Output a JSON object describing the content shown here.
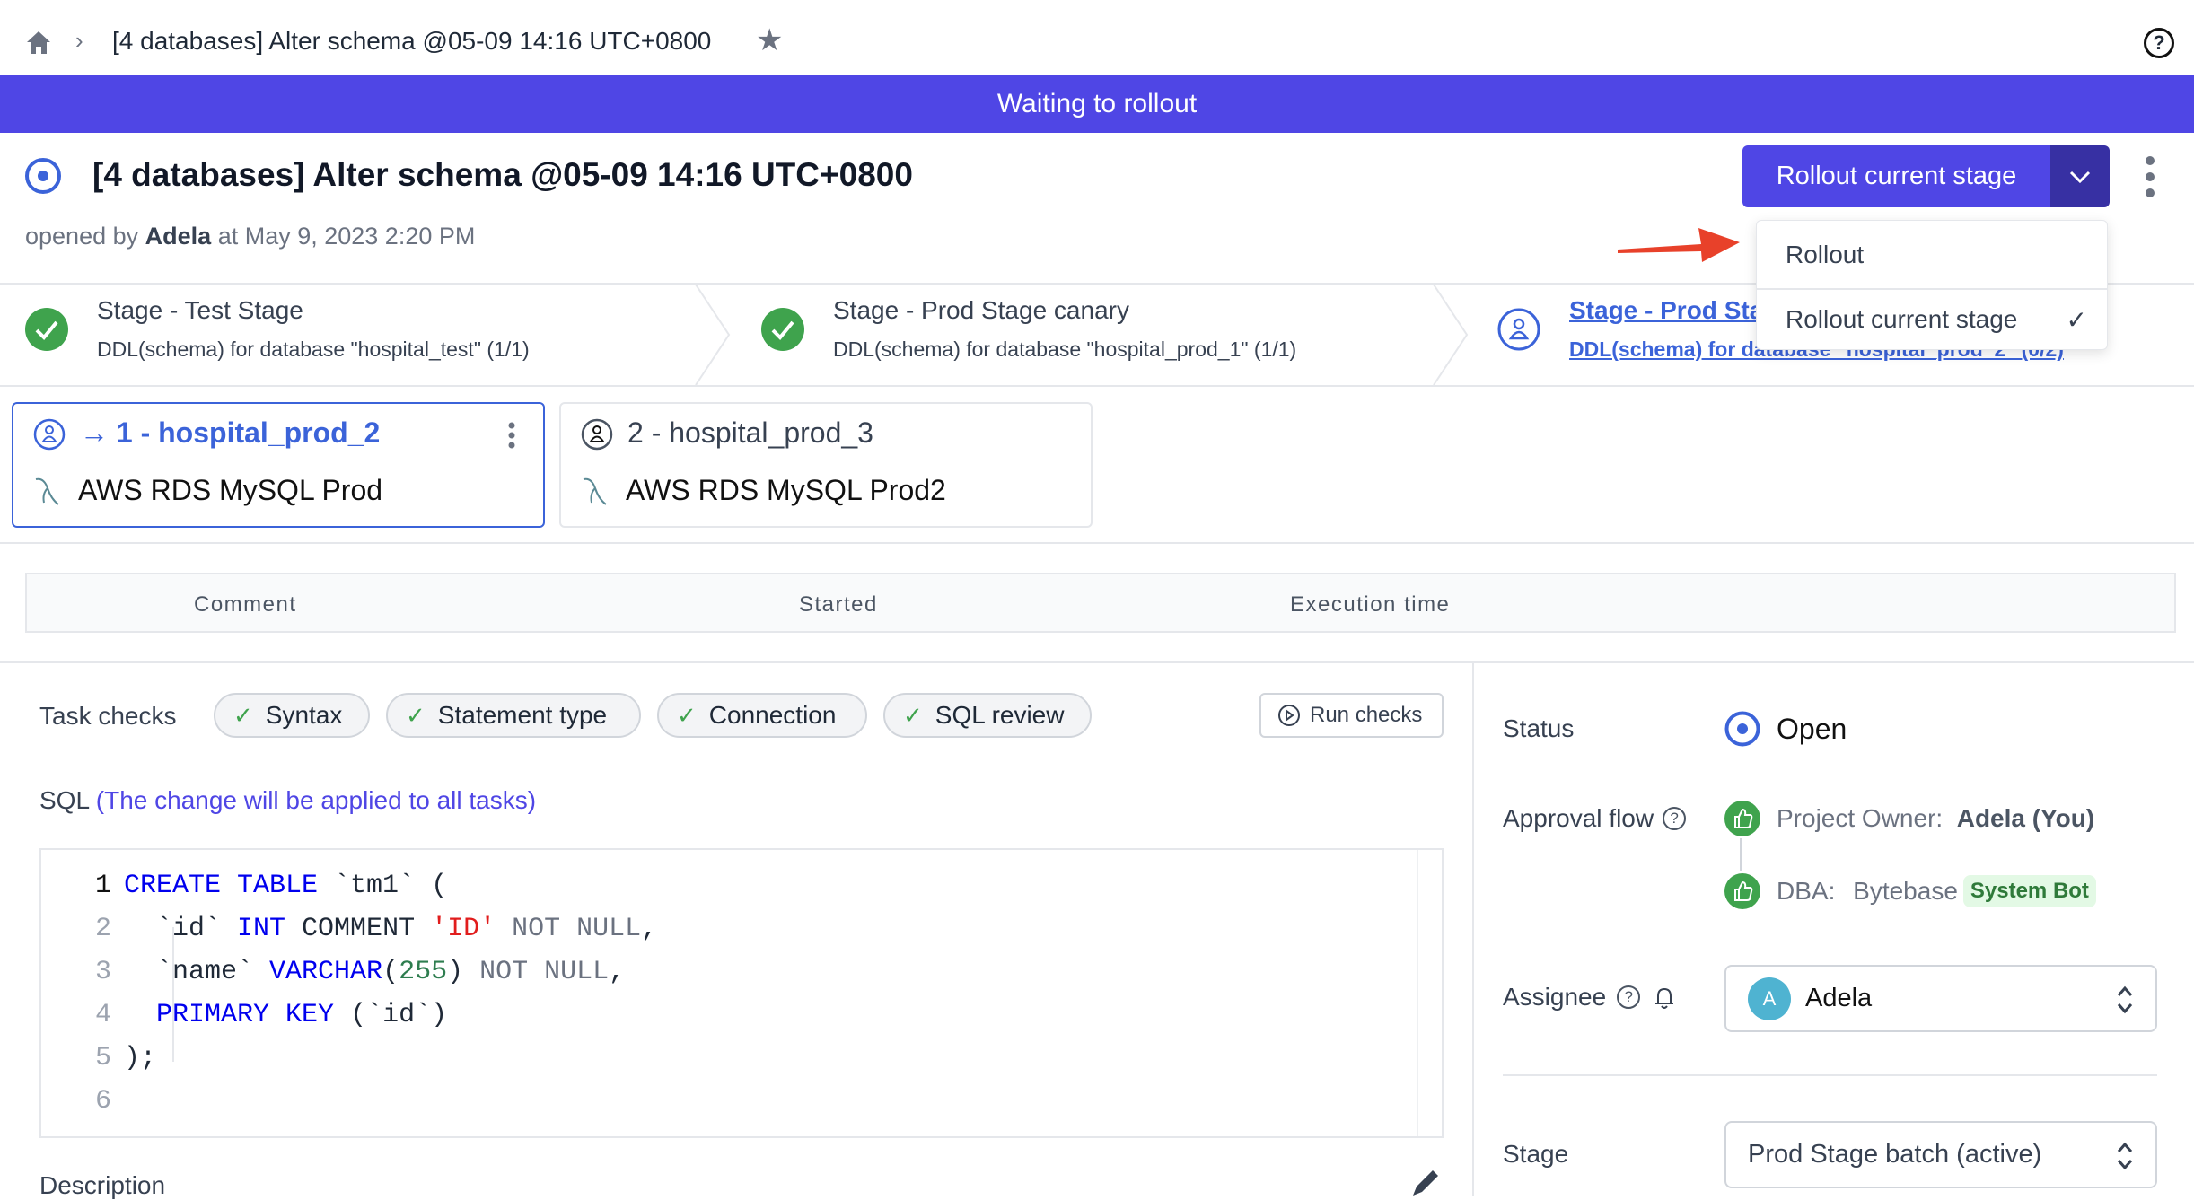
{
  "breadcrumb": {
    "title": "[4 databases] Alter schema @05-09 14:16 UTC+0800"
  },
  "banner": {
    "text": "Waiting to rollout"
  },
  "issue": {
    "title": "[4 databases] Alter schema @05-09 14:16 UTC+0800",
    "opened_prefix": "opened by",
    "author": "Adela",
    "opened_suffix": "at May 9, 2023 2:20 PM"
  },
  "actions": {
    "primary": "Rollout current stage",
    "menu": [
      {
        "label": "Rollout",
        "checked": false
      },
      {
        "label": "Rollout current stage",
        "checked": true
      }
    ]
  },
  "stages": [
    {
      "title": "Stage - Test Stage",
      "subtitle": "DDL(schema) for database \"hospital_test\" (1/1)",
      "status": "done"
    },
    {
      "title": "Stage - Prod Stage canary",
      "subtitle": "DDL(schema) for database \"hospital_prod_1\" (1/1)",
      "status": "done"
    },
    {
      "title": "Stage - Prod Stage batch",
      "subtitle": "DDL(schema) for database \"hospital_prod_2\" (0/2)",
      "status": "active"
    }
  ],
  "tasks": [
    {
      "title": "1 - hospital_prod_2",
      "arrow": "→",
      "instance": "AWS RDS MySQL Prod",
      "active": true
    },
    {
      "title": "2 - hospital_prod_3",
      "instance": "AWS RDS MySQL Prod2",
      "active": false
    }
  ],
  "table": {
    "headers": [
      "Comment",
      "Started",
      "Execution time"
    ]
  },
  "checks": {
    "label": "Task checks",
    "items": [
      "Syntax",
      "Statement type",
      "Connection",
      "SQL review"
    ],
    "run": "Run checks"
  },
  "sql": {
    "label": "SQL",
    "note": "(The change will be applied to all tasks)",
    "line_numbers": [
      "1",
      "2",
      "3",
      "4",
      "5",
      "6"
    ]
  },
  "description": {
    "label": "Description"
  },
  "sidebar": {
    "status_label": "Status",
    "status": "Open",
    "approval_label": "Approval flow",
    "approvals": [
      {
        "role": "Project Owner:",
        "name": "Adela (You)"
      },
      {
        "role": "DBA:",
        "name": "Bytebase",
        "badge": "System Bot"
      }
    ],
    "assignee_label": "Assignee",
    "assignee": "Adela",
    "assignee_initial": "A",
    "stage_label": "Stage",
    "stage": "Prod Stage batch (active)"
  },
  "colors": {
    "accent": "#4f46e5",
    "blue": "#3b63d9",
    "success": "#3fa34d"
  }
}
